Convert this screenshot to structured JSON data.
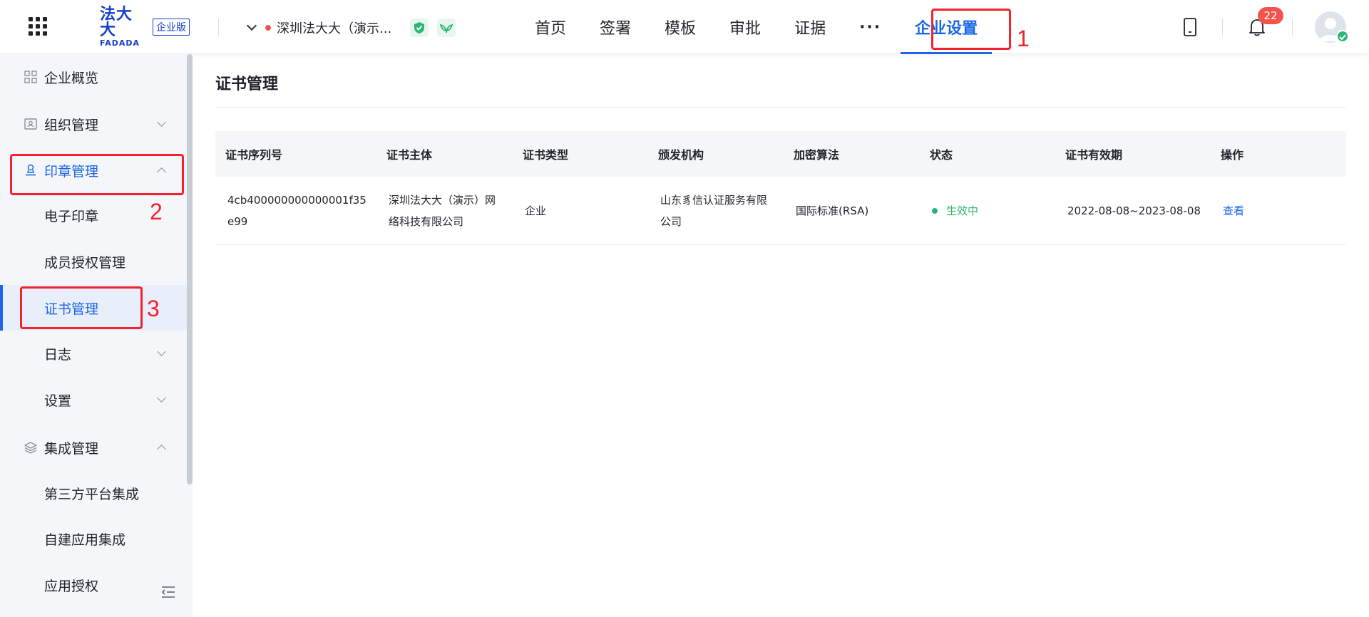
{
  "header": {
    "logo_cn": "法大大",
    "logo_en": "FADADA",
    "logo_badge": "企业版",
    "company_name": "深圳法大大（演示...",
    "nav": [
      {
        "label": "首页"
      },
      {
        "label": "签署"
      },
      {
        "label": "模板"
      },
      {
        "label": "审批"
      },
      {
        "label": "证据"
      },
      {
        "label": "···"
      },
      {
        "label": "企业设置"
      }
    ],
    "notification_count": "22"
  },
  "sidebar": {
    "items": [
      {
        "label": "企业概览"
      },
      {
        "label": "组织管理"
      },
      {
        "label": "印章管理"
      },
      {
        "label": "电子印章"
      },
      {
        "label": "成员授权管理"
      },
      {
        "label": "证书管理"
      },
      {
        "label": "日志"
      },
      {
        "label": "设置"
      },
      {
        "label": "集成管理"
      },
      {
        "label": "第三方平台集成"
      },
      {
        "label": "自建应用集成"
      },
      {
        "label": "应用授权"
      }
    ]
  },
  "annotations": {
    "step1": "1",
    "step2": "2",
    "step3": "3"
  },
  "main": {
    "title": "证书管理",
    "columns": [
      "证书序列号",
      "证书主体",
      "证书类型",
      "颁发机构",
      "加密算法",
      "状态",
      "证书有效期",
      "操作"
    ],
    "rows": [
      {
        "serial": "4cb400000000000001f35e99",
        "subject": "深圳法大大（演示）网络科技有限公司",
        "type": "企业",
        "issuer": "山东豸信认证服务有限公司",
        "algorithm": "国际标准(RSA)",
        "status": "生效中",
        "validity": "2022-08-08~2023-08-08",
        "action": "查看"
      }
    ]
  },
  "colors": {
    "accent": "#1967e6",
    "annotation_red": "#f5222d",
    "status_green": "#2bb673",
    "badge_red": "#f5544b"
  }
}
